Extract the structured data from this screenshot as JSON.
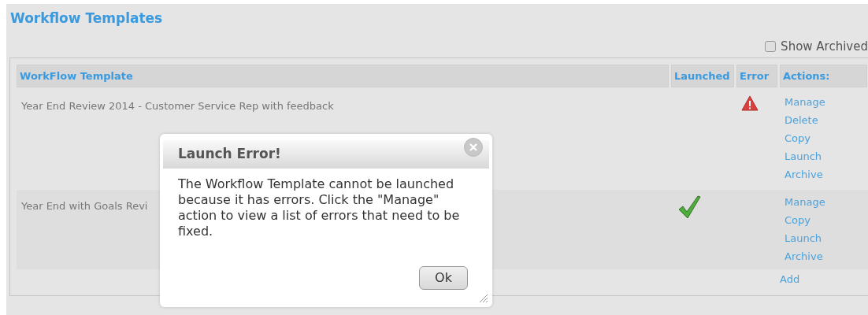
{
  "title": "Workflow Templates",
  "show_archived": {
    "label": "Show Archived",
    "checked": false
  },
  "table": {
    "columns": [
      "WorkFlow Template",
      "Launched",
      "Error",
      "Actions:"
    ],
    "rows": [
      {
        "name": "Year End Review 2014 - Customer Service Rep with feedback",
        "launched": false,
        "error": true,
        "actions": [
          "Manage",
          "Delete",
          "Copy",
          "Launch",
          "Archive"
        ]
      },
      {
        "name": "Year End with Goals Revi",
        "launched": true,
        "error": false,
        "actions": [
          "Manage",
          "Copy",
          "Launch",
          "Archive"
        ]
      }
    ],
    "add_link": "Add"
  },
  "dialog": {
    "title": "Launch Error!",
    "message": "The Workflow Template cannot be launched because it has errors. Click the \"Manage\" action to view a list of errors that need to be fixed.",
    "button": "Ok"
  }
}
